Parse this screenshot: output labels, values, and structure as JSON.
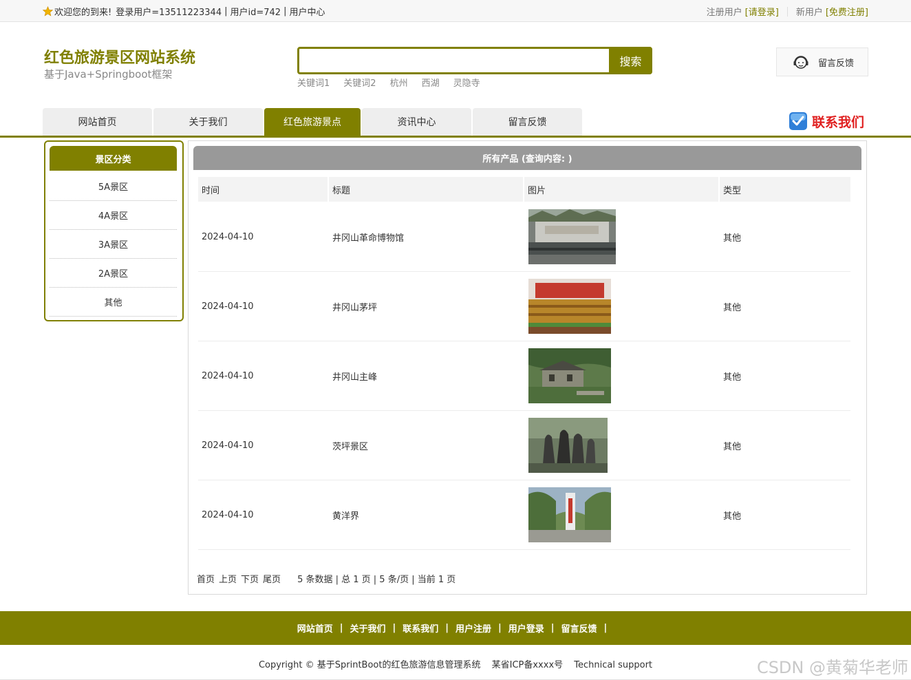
{
  "topbar": {
    "welcome": "欢迎您的到来!",
    "login_user": "登录用户=13511223344",
    "user_id": "用户id=742",
    "user_center": "用户中心",
    "registered_label": "注册用户",
    "login_link": "[请登录]",
    "new_user_label": "新用户",
    "register_link": "[免费注册]"
  },
  "header": {
    "title": "红色旅游景区网站系统",
    "subtitle": "基于Java+Springboot框架",
    "search_button": "搜索",
    "search_value": "",
    "keywords": [
      "关键词1",
      "关键词2",
      "杭州",
      "西湖",
      "灵隐寺"
    ],
    "feedback": "留言反馈"
  },
  "nav": {
    "tabs": [
      "网站首页",
      "关于我们",
      "红色旅游景点",
      "资讯中心",
      "留言反馈"
    ],
    "active_index": 2,
    "contact": "联系我们"
  },
  "sidebar": {
    "title": "景区分类",
    "items": [
      "5A景区",
      "4A景区",
      "3A景区",
      "2A景区",
      "其他"
    ]
  },
  "main": {
    "title": "所有产品 (查询内容: )",
    "columns": [
      "时间",
      "标题",
      "图片",
      "类型"
    ],
    "rows": [
      {
        "date": "2024-04-10",
        "title": "井冈山革命博物馆",
        "type": "其他"
      },
      {
        "date": "2024-04-10",
        "title": "井冈山茅坪",
        "type": "其他"
      },
      {
        "date": "2024-04-10",
        "title": "井冈山主峰",
        "type": "其他"
      },
      {
        "date": "2024-04-10",
        "title": "茨坪景区",
        "type": "其他"
      },
      {
        "date": "2024-04-10",
        "title": "黄洋界",
        "type": "其他"
      }
    ],
    "pager": {
      "first": "首页",
      "prev": "上页",
      "next": "下页",
      "last": "尾页",
      "summary": "5 条数据 | 总 1 页 | 5 条/页 | 当前 1 页"
    }
  },
  "footer": {
    "links": [
      "网站首页",
      "关于我们",
      "联系我们",
      "用户注册",
      "用户登录",
      "留言反馈"
    ],
    "copyright": "Copyright © 基于SprintBoot的红色旅游信息管理系统",
    "icp": "某省ICP备xxxx号",
    "support": "Technical support",
    "watermark": "CSDN @黄菊华老师"
  },
  "colors": {
    "accent": "#808000",
    "panel_header": "#999999",
    "contact_red": "#e02020"
  },
  "icons": [
    "star-icon",
    "headset-icon",
    "phone-check-icon"
  ]
}
